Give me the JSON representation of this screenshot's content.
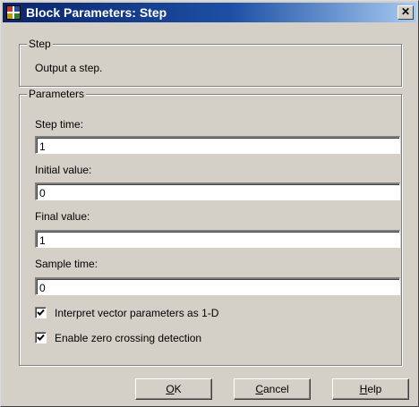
{
  "window": {
    "title": "Block Parameters: Step"
  },
  "step_group": {
    "legend": "Step",
    "description": "Output a step."
  },
  "parameters_group": {
    "legend": "Parameters",
    "fields": [
      {
        "label": "Step time:",
        "value": "1"
      },
      {
        "label": "Initial value:",
        "value": "0"
      },
      {
        "label": "Final value:",
        "value": "1"
      },
      {
        "label": "Sample time:",
        "value": "0"
      }
    ],
    "checkboxes": [
      {
        "label": "Interpret vector parameters as 1-D",
        "checked": true
      },
      {
        "label": "Enable zero crossing detection",
        "checked": true
      }
    ]
  },
  "buttons": {
    "ok": {
      "first": "O",
      "rest": "K"
    },
    "cancel": {
      "first": "C",
      "rest": "ancel"
    },
    "help": {
      "first": "H",
      "rest": "elp"
    }
  },
  "icons": {
    "app": "simulink-block-icon",
    "close": "close-icon",
    "check": "check-icon"
  },
  "colors": {
    "title_bar": "#0a246a",
    "face": "#d4d0c8"
  }
}
